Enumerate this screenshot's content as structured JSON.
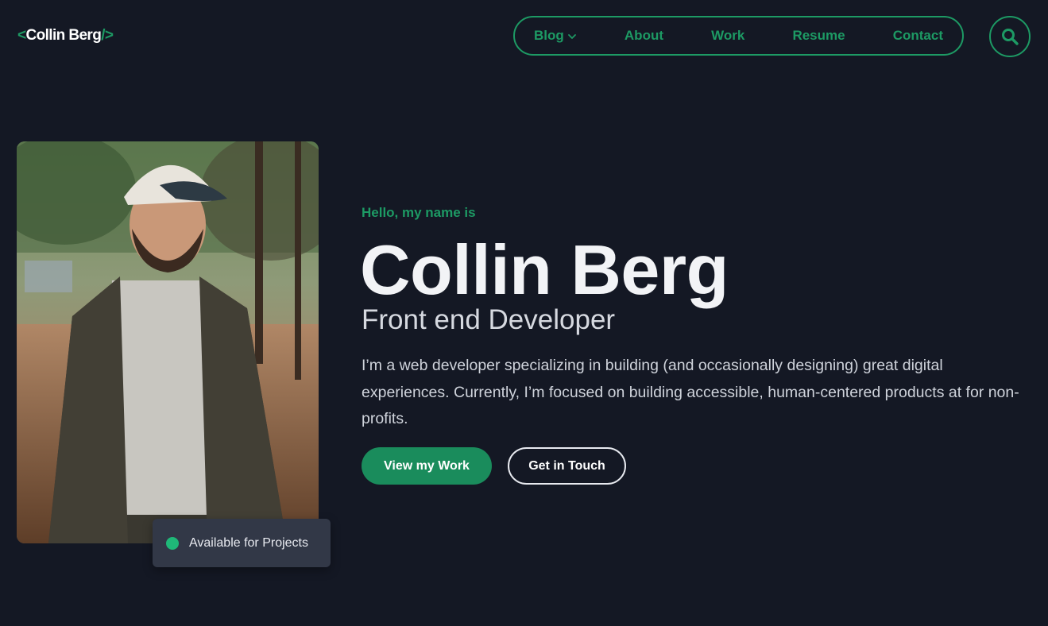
{
  "header": {
    "logo": {
      "open": "<",
      "name": "Collin Berg",
      "close": "/>"
    },
    "nav": [
      {
        "label": "Blog",
        "has_dropdown": true
      },
      {
        "label": "About"
      },
      {
        "label": "Work"
      },
      {
        "label": "Resume"
      },
      {
        "label": "Contact"
      }
    ],
    "search_icon": "search-icon"
  },
  "hero": {
    "greeting": "Hello, my name is",
    "name": "Collin Berg",
    "role": "Front end Developer",
    "bio": "I’m a web developer specializing in building (and occasionally designing) great digital experiences. Currently, I’m focused on building accessible, human-centered products at for non-profits.",
    "primary_button": "View my Work",
    "secondary_button": "Get in Touch"
  },
  "badge": {
    "label": "Available for Projects",
    "status_color": "#1fb878"
  },
  "colors": {
    "accent": "#1d9a64",
    "background": "#141824",
    "badge_bg": "#323847"
  }
}
